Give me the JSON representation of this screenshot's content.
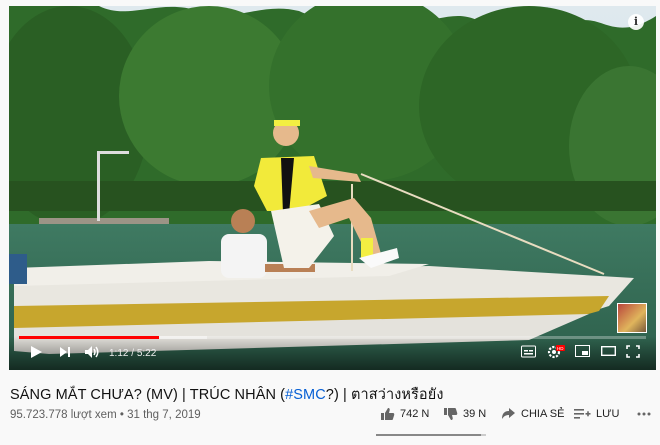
{
  "player": {
    "current_time": "1:12",
    "duration": "5:22",
    "time_separator": "/",
    "progress_fraction": 0.224,
    "buffered_fraction": 0.3,
    "info_label": "i",
    "accent_color": "#ff0000"
  },
  "video": {
    "title_prefix": "SÁNG MẮT CHƯA? (MV) | TRÚC NHÂN (",
    "title_hashtag": "#SMC",
    "title_suffix": "?) | ตาสว่างหรือยัง",
    "views": "95.723.778 lượt xem",
    "separator": "•",
    "date": "31 thg 7, 2019"
  },
  "actions": {
    "like_count": "742 N",
    "dislike_count": "39 N",
    "share_label": "CHIA SẺ",
    "save_label": "LƯU",
    "like_ratio": 0.95
  },
  "icons": [
    "play-icon",
    "next-icon",
    "volume-icon",
    "subtitles-icon",
    "settings-icon",
    "miniplayer-icon",
    "theater-icon",
    "fullscreen-icon",
    "like-icon",
    "dislike-icon",
    "share-icon",
    "save-icon",
    "info-icon"
  ]
}
